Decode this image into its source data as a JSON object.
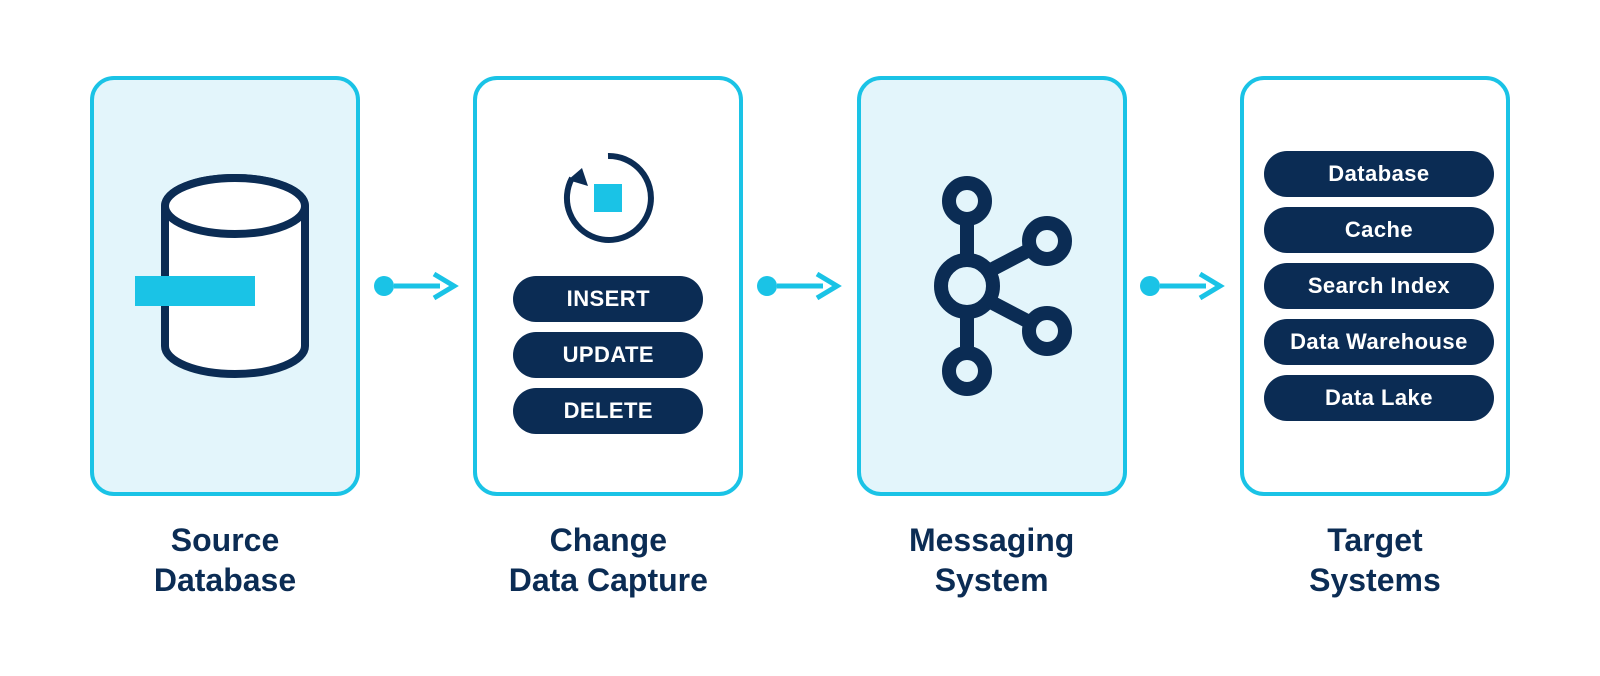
{
  "colors": {
    "accent": "#1ac3e6",
    "dark": "#0b2c54",
    "panel": "#e3f5fb"
  },
  "nodes": {
    "source": {
      "label": "Source\nDatabase"
    },
    "cdc": {
      "label": "Change\nData Capture",
      "ops": [
        "INSERT",
        "UPDATE",
        "DELETE"
      ]
    },
    "messaging": {
      "label": "Messaging\nSystem"
    },
    "targets": {
      "label": "Target\nSystems",
      "items": [
        "Database",
        "Cache",
        "Search Index",
        "Data Warehouse",
        "Data Lake"
      ]
    }
  }
}
